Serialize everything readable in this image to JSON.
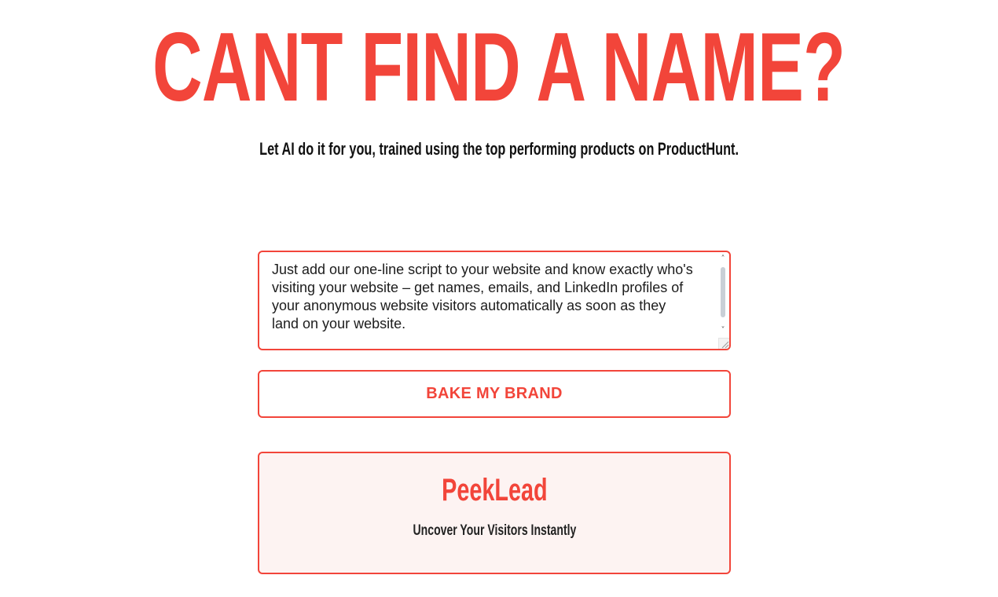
{
  "hero": {
    "title": "CANT FIND A NAME?",
    "subtitle": "Let AI do it for you, trained using the top performing products on ProductHunt."
  },
  "form": {
    "description_value": "Just add our one-line script to your website and know exactly who's visiting your website – get names, emails, and LinkedIn profiles of your anonymous website visitors automatically as soon as they land on your website.",
    "submit_label": "BAKE MY BRAND"
  },
  "result": {
    "name": "PeekLead",
    "tagline": "Uncover Your Visitors Instantly"
  },
  "colors": {
    "accent": "#f2453a",
    "card_background": "#fdf3f2",
    "text": "#111111"
  },
  "icons": {
    "scroll_up": "chevron-up-icon",
    "scroll_down": "chevron-down-icon",
    "resize": "resize-grip-icon"
  }
}
